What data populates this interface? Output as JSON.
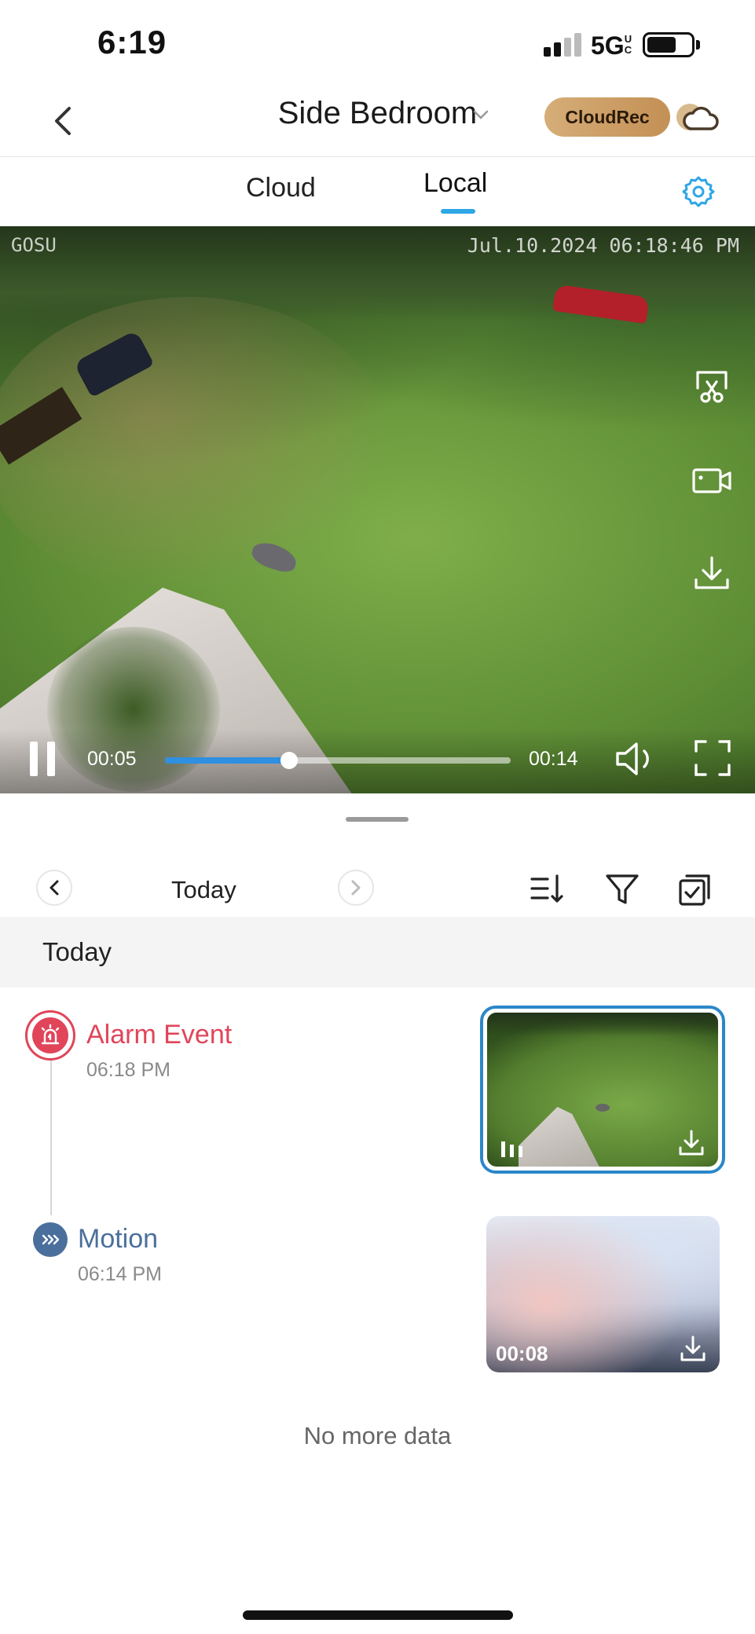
{
  "status_bar": {
    "time": "6:19",
    "network": "5G",
    "network_suffix": "UC",
    "signal_bars_on": 2,
    "signal_bars_total": 4,
    "battery_level": 0.65
  },
  "header": {
    "title": "Side Bedroom",
    "cloudrec_label": "CloudRec",
    "icons": [
      "back-icon",
      "chevron-down-icon",
      "cloud-icon"
    ]
  },
  "tabs": {
    "items": [
      {
        "label": "Cloud",
        "active": false
      },
      {
        "label": "Local",
        "active": true
      }
    ],
    "accent_color": "#2fa6e6",
    "settings_icon": "gear-icon"
  },
  "player": {
    "osd_brand": "GOSU",
    "osd_timestamp": "Jul.10.2024 06:18:46 PM",
    "current_time": "00:05",
    "total_time": "00:14",
    "progress": 0.36,
    "accent_color": "#2f8fe0",
    "side_actions": [
      "clip-icon",
      "record-icon",
      "download-icon"
    ],
    "control_icons": [
      "pause-icon",
      "volume-icon",
      "fullscreen-icon"
    ]
  },
  "date_nav": {
    "label": "Today",
    "tools": [
      "sort-icon",
      "filter-icon",
      "multi-select-icon"
    ]
  },
  "section": {
    "label": "Today"
  },
  "events": [
    {
      "title": "Alarm Event",
      "time": "06:18 PM",
      "color": "#e0455a",
      "icon": "alarm-siren-icon",
      "selected": true,
      "duration": ""
    },
    {
      "title": "Motion",
      "time": "06:14 PM",
      "color": "#4a6f9c",
      "icon": "motion-icon",
      "selected": false,
      "duration": "00:08"
    }
  ],
  "footer": {
    "no_more_label": "No more data"
  }
}
